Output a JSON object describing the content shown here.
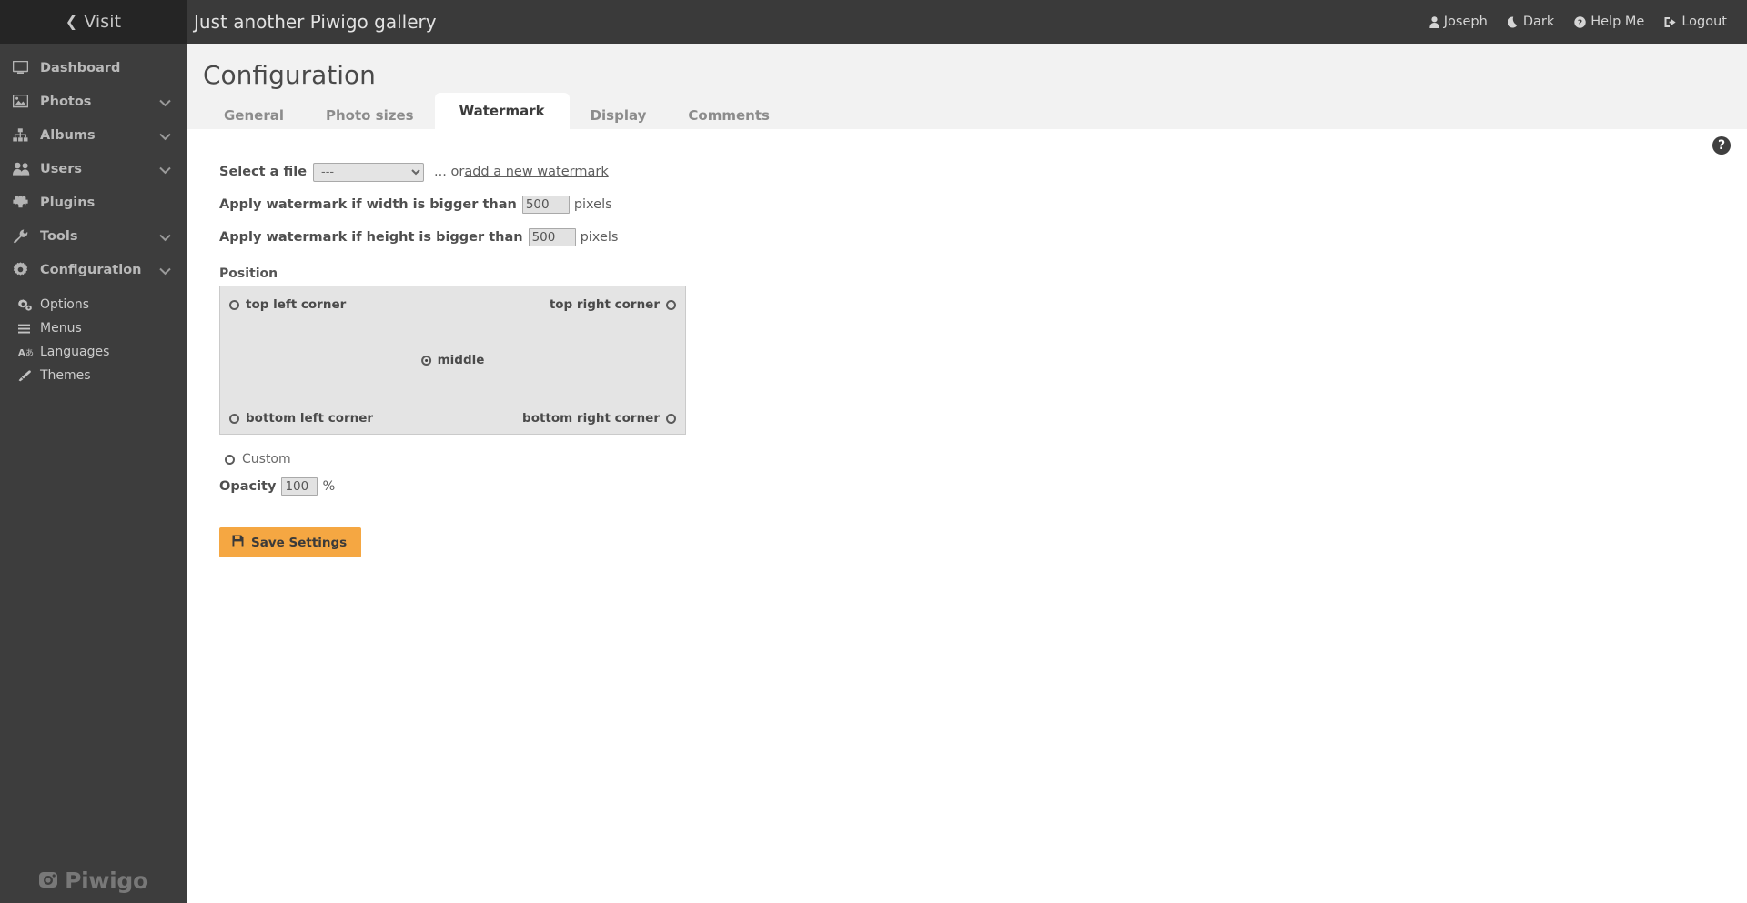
{
  "header": {
    "visit_label": "Visit",
    "visit_icon": "chevron-left-icon",
    "gallery_title": "Just another Piwigo gallery",
    "right_items": [
      {
        "label": "Joseph",
        "icon": "user-icon"
      },
      {
        "label": "Dark",
        "icon": "moon-icon"
      },
      {
        "label": "Help Me",
        "icon": "question-circle-icon"
      },
      {
        "label": "Logout",
        "icon": "logout-icon"
      }
    ]
  },
  "sidebar": {
    "items": [
      {
        "label": "Dashboard",
        "icon": "monitor-icon",
        "expandable": false
      },
      {
        "label": "Photos",
        "icon": "image-icon",
        "expandable": true
      },
      {
        "label": "Albums",
        "icon": "sitemap-icon",
        "expandable": true
      },
      {
        "label": "Users",
        "icon": "users-icon",
        "expandable": true
      },
      {
        "label": "Plugins",
        "icon": "puzzle-icon",
        "expandable": false
      },
      {
        "label": "Tools",
        "icon": "wrench-icon",
        "expandable": true
      },
      {
        "label": "Configuration",
        "icon": "gear-icon",
        "expandable": true
      }
    ],
    "sub_items": [
      {
        "label": "Options",
        "icon": "gears-icon"
      },
      {
        "label": "Menus",
        "icon": "hamburger-icon"
      },
      {
        "label": "Languages",
        "icon": "language-icon"
      },
      {
        "label": "Themes",
        "icon": "paintbrush-icon"
      }
    ],
    "logo_text": "Piwigo",
    "logo_icon": "aperture-icon"
  },
  "page": {
    "title": "Configuration",
    "help_icon": "question-mark-icon",
    "help_glyph": "?"
  },
  "tabs": [
    {
      "label": "General",
      "active": false
    },
    {
      "label": "Photo sizes",
      "active": false
    },
    {
      "label": "Watermark",
      "active": true
    },
    {
      "label": "Display",
      "active": false
    },
    {
      "label": "Comments",
      "active": false
    }
  ],
  "form": {
    "select_file_label": "Select a file",
    "select_file_value": "---",
    "select_file_options": [
      "---"
    ],
    "or_text": "... or ",
    "add_watermark_link": "add a new watermark",
    "width_label": "Apply watermark if width is bigger than",
    "width_value": "500",
    "width_unit": "pixels",
    "height_label": "Apply watermark if height is bigger than",
    "height_value": "500",
    "height_unit": "pixels",
    "position_label": "Position",
    "positions": [
      {
        "key": "top-left",
        "label": "top left corner",
        "selected": false
      },
      {
        "key": "top-right",
        "label": "top right corner",
        "selected": false
      },
      {
        "key": "middle",
        "label": "middle",
        "selected": true
      },
      {
        "key": "bottom-left",
        "label": "bottom left corner",
        "selected": false
      },
      {
        "key": "bottom-right",
        "label": "bottom right corner",
        "selected": false
      }
    ],
    "custom_label": "Custom",
    "custom_selected": false,
    "opacity_label": "Opacity",
    "opacity_value": "100",
    "opacity_unit": "%",
    "save_label": "Save Settings",
    "save_icon": "floppy-disk-icon"
  },
  "colors": {
    "accent": "#f5a742",
    "sidebar_bg": "#3d3d3d",
    "header_bg": "#3a3a3a",
    "visit_bg": "#252525",
    "page_head_bg": "#f2f2f2",
    "field_bg": "#e2e2e2",
    "position_box_bg": "#e4e4e4"
  }
}
